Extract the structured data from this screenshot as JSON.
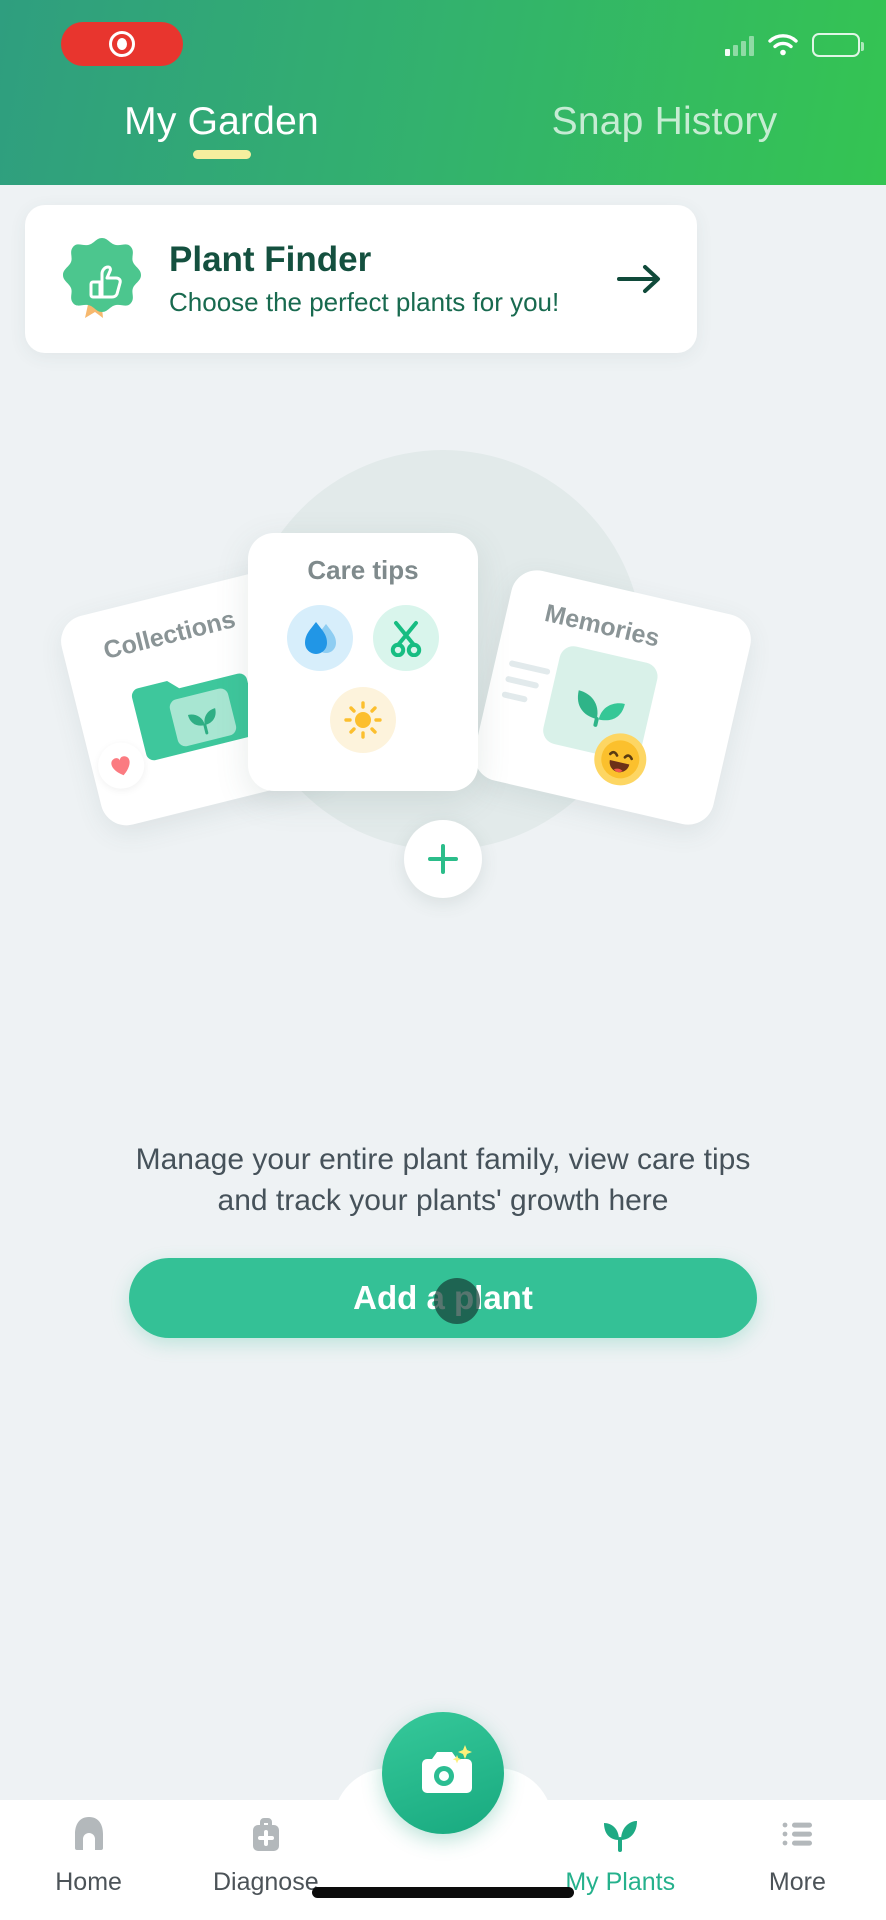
{
  "status_bar": {
    "recording_indicator": "recording-pill",
    "signal_icon": "cellular-signal-icon",
    "wifi_icon": "wifi-icon",
    "battery_icon": "battery-icon"
  },
  "header": {
    "tabs": [
      {
        "label": "My Garden",
        "active": true
      },
      {
        "label": "Snap History",
        "active": false
      }
    ],
    "accent_underline_color": "#f5ee9e",
    "gradient_from": "#2f9e7f",
    "gradient_to": "#34c452"
  },
  "plant_finder": {
    "title": "Plant Finder",
    "subtitle": "Choose the perfect plants for you!",
    "badge_icon": "thumbs-up-badge-icon",
    "arrow_icon": "arrow-right-icon",
    "title_color": "#14503f",
    "badge_color": "#4cc68e"
  },
  "illustration": {
    "cards": [
      {
        "label": "Collections",
        "icons": [
          "folder-plant-icon",
          "heart-icon"
        ]
      },
      {
        "label": "Care tips",
        "icons": [
          "water-drop-icon",
          "scissors-icon",
          "sun-icon"
        ]
      },
      {
        "label": "Memories",
        "icons": [
          "photo-sprout-icon",
          "smiley-emoji-icon"
        ]
      }
    ],
    "add_button_icon": "plus-icon"
  },
  "empty_state": {
    "line1": "Manage your entire plant family, view care tips",
    "line2": "and track your plants' growth here",
    "cta_label": "Add a plant",
    "cta_color": "#34c196"
  },
  "bottom_nav": {
    "items": [
      {
        "label": "Home",
        "icon": "home-icon",
        "active": false
      },
      {
        "label": "Diagnose",
        "icon": "medical-bag-icon",
        "active": false
      },
      {
        "label": "",
        "icon": "camera-icon",
        "active": false
      },
      {
        "label": "My Plants",
        "icon": "sprout-icon",
        "active": true
      },
      {
        "label": "More",
        "icon": "list-menu-icon",
        "active": false
      }
    ],
    "active_color": "#25b18c",
    "inactive_color": "#4c5358"
  }
}
